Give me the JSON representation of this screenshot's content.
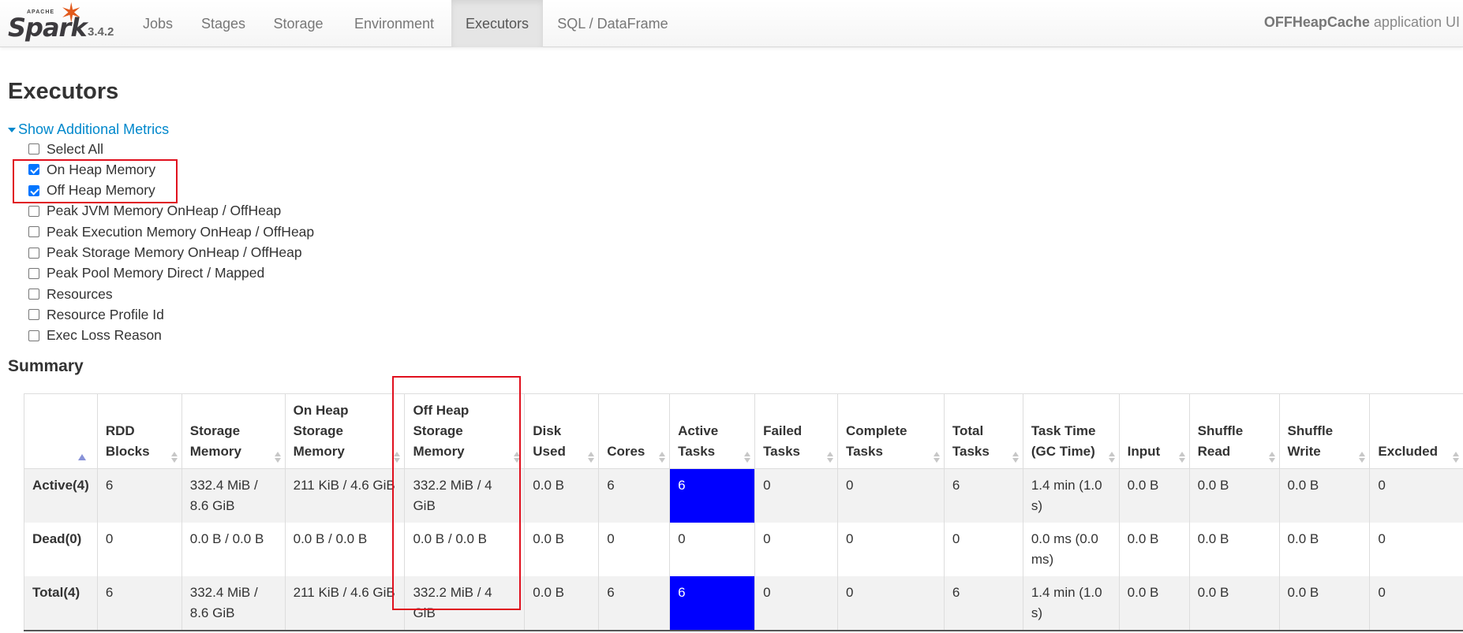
{
  "navbar": {
    "brand": {
      "apache": "APACHE",
      "spark": "Spark",
      "version": "3.4.2"
    },
    "tabs": [
      "Jobs",
      "Stages",
      "Storage",
      "Environment",
      "Executors",
      "SQL / DataFrame"
    ],
    "active_tab": "Executors",
    "app_name": "OFFHeapCache",
    "app_suffix": "application UI"
  },
  "page": {
    "title": "Executors",
    "toggle_label": "Show Additional Metrics",
    "metrics": [
      {
        "label": "Select All",
        "checked": false
      },
      {
        "label": "On Heap Memory",
        "checked": true
      },
      {
        "label": "Off Heap Memory",
        "checked": true
      },
      {
        "label": "Peak JVM Memory OnHeap / OffHeap",
        "checked": false
      },
      {
        "label": "Peak Execution Memory OnHeap / OffHeap",
        "checked": false
      },
      {
        "label": "Peak Storage Memory OnHeap / OffHeap",
        "checked": false
      },
      {
        "label": "Peak Pool Memory Direct / Mapped",
        "checked": false
      },
      {
        "label": "Resources",
        "checked": false
      },
      {
        "label": "Resource Profile Id",
        "checked": false
      },
      {
        "label": "Exec Loss Reason",
        "checked": false
      }
    ],
    "summary_title": "Summary"
  },
  "summary_table": {
    "headers": [
      "",
      "RDD Blocks",
      "Storage Memory",
      "On Heap Storage Memory",
      "Off Heap Storage Memory",
      "Disk Used",
      "Cores",
      "Active Tasks",
      "Failed Tasks",
      "Complete Tasks",
      "Total Tasks",
      "Task Time (GC Time)",
      "Input",
      "Shuffle Read",
      "Shuffle Write",
      "Excluded"
    ],
    "rows": [
      [
        "Active(4)",
        "6",
        "332.4 MiB / 8.6 GiB",
        "211 KiB / 4.6 GiB",
        "332.2 MiB / 4 GiB",
        "0.0 B",
        "6",
        "6",
        "0",
        "0",
        "6",
        "1.4 min (1.0 s)",
        "0.0 B",
        "0.0 B",
        "0.0 B",
        "0"
      ],
      [
        "Dead(0)",
        "0",
        "0.0 B / 0.0 B",
        "0.0 B / 0.0 B",
        "0.0 B / 0.0 B",
        "0.0 B",
        "0",
        "0",
        "0",
        "0",
        "0",
        "0.0 ms (0.0 ms)",
        "0.0 B",
        "0.0 B",
        "0.0 B",
        "0"
      ],
      [
        "Total(4)",
        "6",
        "332.4 MiB / 8.6 GiB",
        "211 KiB / 4.6 GiB",
        "332.2 MiB / 4 GiB",
        "0.0 B",
        "6",
        "6",
        "0",
        "0",
        "6",
        "1.4 min (1.0 s)",
        "0.0 B",
        "0.0 B",
        "0.0 B",
        "0"
      ]
    ]
  },
  "colors": {
    "link": "#0088cc",
    "active_tasks_bg": "#0000ff",
    "annotation": "#e0101e",
    "spark_orange": "#e25a1c"
  }
}
